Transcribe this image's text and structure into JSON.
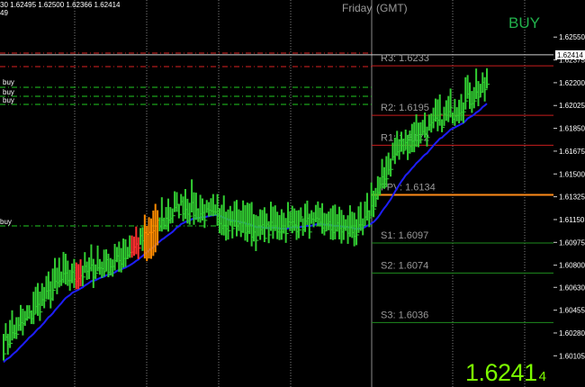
{
  "header": {
    "ohlc_text": "30  1.62495  1.62500  1.62366  1.62414",
    "line2": "49"
  },
  "session": {
    "day": "Friday",
    "tz": "(GMT)"
  },
  "signal": "BUY",
  "big_price": {
    "main": "1.6241",
    "sub": "4"
  },
  "current_price_label": "1.62414",
  "left_tags": [
    "buy",
    "buy",
    "buy",
    "buy"
  ],
  "colors": {
    "background": "#000000",
    "bull_bar": "#32cd32",
    "bear_bar": "#ff8c00",
    "highlight_bar": "#ff3030",
    "ma_line": "#1e1eff",
    "ma_fill": "#3a3aff",
    "resistance": "#c81e1e",
    "support": "#1e8c1e",
    "pivot": "#ff8c1a",
    "grid": "#7f7f7f",
    "level_text": "#9a9a9a"
  },
  "chart_data": {
    "type": "ohlc",
    "y_axis": {
      "side": "right",
      "min": 1.599,
      "max": 1.628,
      "ticks": [
        "1.62550",
        "1.62375",
        "1.62200",
        "1.62025",
        "1.61850",
        "1.61675",
        "1.61500",
        "1.61325",
        "1.61150",
        "1.60975",
        "1.60800",
        "1.60630",
        "1.60455",
        "1.60280",
        "1.60105"
      ]
    },
    "pivot_levels": [
      {
        "name": "R3",
        "value": 1.6233,
        "label": "R3:  1.6233",
        "kind": "resistance"
      },
      {
        "name": "R2",
        "value": 1.6195,
        "label": "R2:  1.6195",
        "kind": "resistance"
      },
      {
        "name": "R1",
        "value": 1.6172,
        "label": "R1:  1.6172",
        "kind": "resistance"
      },
      {
        "name": "FPV",
        "value": 1.6134,
        "label": "FPV:  1.6134",
        "kind": "pivot"
      },
      {
        "name": "S1",
        "value": 1.6097,
        "label": "S1:  1.6097",
        "kind": "support"
      },
      {
        "name": "S2",
        "value": 1.6074,
        "label": "S2:  1.6074",
        "kind": "support"
      },
      {
        "name": "S3",
        "value": 1.6036,
        "label": "S3:  1.6036",
        "kind": "support"
      }
    ],
    "current_price": 1.62414,
    "ma_start": 1.6005,
    "bar_range": 0.0013,
    "bar_counts": [
      27,
      26,
      30,
      35,
      21,
      28,
      16,
      44
    ],
    "anchors": [
      1.6018,
      1.6068,
      1.6082,
      1.6125,
      1.6105,
      1.6112,
      1.6105,
      1.6165,
      1.6218
    ],
    "bear_bars": [
      66,
      67,
      68,
      69,
      70,
      71,
      72
    ],
    "red_bars": [
      34,
      35,
      36,
      60,
      61,
      62,
      63
    ]
  }
}
